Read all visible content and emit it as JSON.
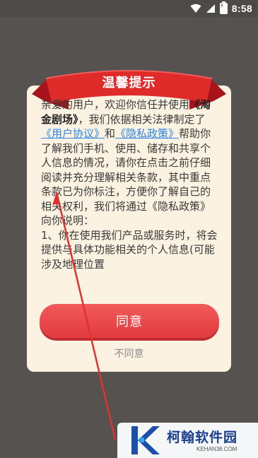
{
  "status_bar": {
    "time": "8:58",
    "icons": [
      "wifi-icon",
      "signal-icon",
      "battery-charging-icon"
    ]
  },
  "dialog": {
    "title": "温馨提示",
    "paragraph1": {
      "lead": "亲爱的用户，欢迎你信任并使用",
      "app_name": "《淘金剧场》",
      "mid1": "，我们依据相关法律制定了",
      "user_agreement": "《用户协议》",
      "and": "和",
      "privacy_policy": "《隐私政策》",
      "tail": "帮助你了解我们手机、使用、储存和共享个人信息的情况，请你在点击之前仔细阅读并充分理解相关条款，其中重点条款已为你标注，方便你了解自己的相关权利，我们将通过《隐私政策》向你说明："
    },
    "item1": "1、你在使用我们产品或服务时，将会提供与具体功能相关的个人信息(可能涉及地理位置",
    "agree_label": "同意",
    "disagree_label": "不同意"
  },
  "watermark": {
    "name": "柯翰软件园",
    "url": "KEHAN38.COM"
  },
  "colors": {
    "overlay": "#555250",
    "card": "#fbf2e1",
    "banner": "#e02b2b",
    "button": "#e8434a",
    "link": "#2b86e8",
    "arrow": "#e0322f"
  }
}
